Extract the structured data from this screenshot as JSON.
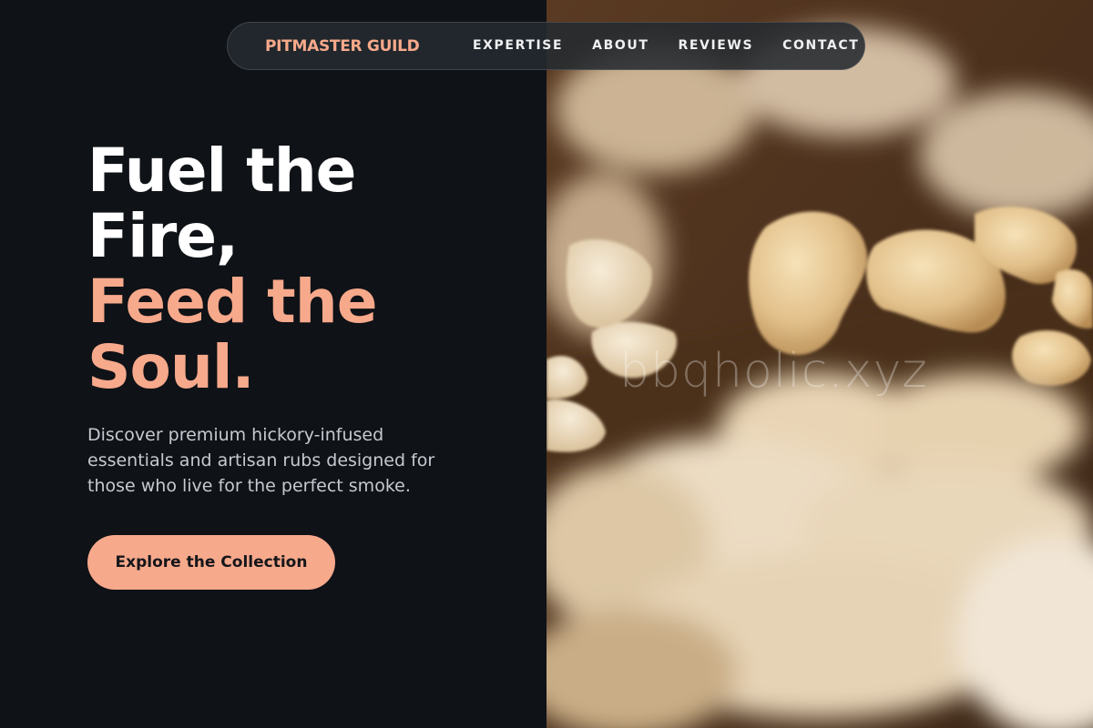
{
  "brand": {
    "name": "PITMASTER GUILD",
    "accent_color": "#f7a98b"
  },
  "nav": {
    "links": [
      {
        "label": "EXPERTISE"
      },
      {
        "label": "ABOUT"
      },
      {
        "label": "REVIEWS"
      },
      {
        "label": "CONTACT"
      }
    ]
  },
  "hero": {
    "headline_line1": "Fuel the",
    "headline_line2": "Fire,",
    "headline_line3": "Feed the",
    "headline_line4": "Soul.",
    "subtitle": "Discover premium hickory-infused essentials and artisan rubs designed for those who live for the perfect smoke.",
    "cta_label": "Explore the Collection"
  },
  "image": {
    "subject": "cashew-nuts-on-wooden-board",
    "watermark": "bbqholic.xyz"
  },
  "colors": {
    "background": "#0f1217",
    "accent": "#f7a98b",
    "headline_white": "#ffffff",
    "subtitle": "#c6cad0"
  }
}
